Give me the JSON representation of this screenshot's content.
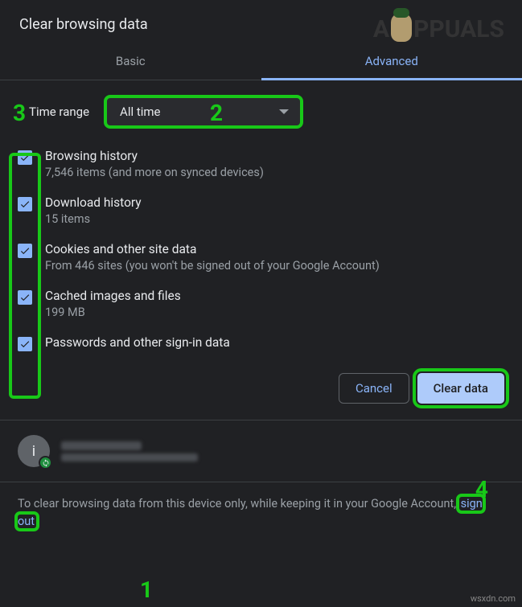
{
  "title": "Clear browsing data",
  "tabs": {
    "basic": "Basic",
    "advanced": "Advanced",
    "active": "advanced"
  },
  "range": {
    "label": "Time range",
    "value": "All time"
  },
  "items": [
    {
      "title": "Browsing history",
      "subtitle": "7,546 items (and more on synced devices)",
      "checked": true
    },
    {
      "title": "Download history",
      "subtitle": "15 items",
      "checked": true
    },
    {
      "title": "Cookies and other site data",
      "subtitle": "From 446 sites (you won't be signed out of your Google Account)",
      "checked": true
    },
    {
      "title": "Cached images and files",
      "subtitle": "199 MB",
      "checked": true
    },
    {
      "title": "Passwords and other sign-in data",
      "subtitle": "",
      "checked": true
    }
  ],
  "actions": {
    "cancel": "Cancel",
    "clear": "Clear data"
  },
  "account": {
    "initial": "i"
  },
  "footer": {
    "before": "To clear browsing data from this device only, while keeping it in your Google Account, ",
    "link": "sign out",
    "after": "."
  },
  "annotations": {
    "num1": "1",
    "num2": "2",
    "num3": "3",
    "num4": "4"
  },
  "watermark": "wsxdn.com",
  "brand": {
    "a": "A",
    "ppuals": "PPUALS"
  }
}
